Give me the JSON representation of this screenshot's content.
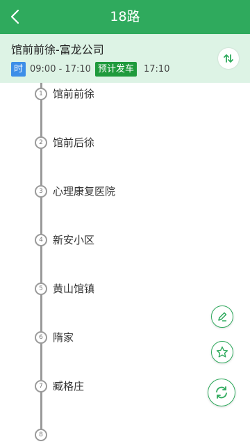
{
  "header": {
    "title": "18路",
    "back_icon": "chevron-left-icon"
  },
  "route": {
    "name": "馆前前徐-富龙公司",
    "time_tag": "时",
    "hours": "09:00 - 17:10",
    "depart_tag": "预计发车",
    "depart_time": "17:10",
    "swap_icon": "swap-direction-icon"
  },
  "stops": [
    {
      "num": "1",
      "name": "馆前前徐"
    },
    {
      "num": "2",
      "name": "馆前后徐"
    },
    {
      "num": "3",
      "name": "心理康复医院"
    },
    {
      "num": "4",
      "name": "新安小区"
    },
    {
      "num": "5",
      "name": "黄山馆镇"
    },
    {
      "num": "6",
      "name": "隋家"
    },
    {
      "num": "7",
      "name": "臧格庄"
    },
    {
      "num": "8",
      "name": ""
    }
  ],
  "actions": {
    "edit_icon": "pencil-icon",
    "favorite_icon": "star-icon",
    "refresh_icon": "refresh-icon"
  },
  "colors": {
    "primary": "#2faa5d",
    "info_bg": "#ddf3e5",
    "time_tag": "#3d8ee8",
    "depart_tag": "#1f9a3c"
  }
}
